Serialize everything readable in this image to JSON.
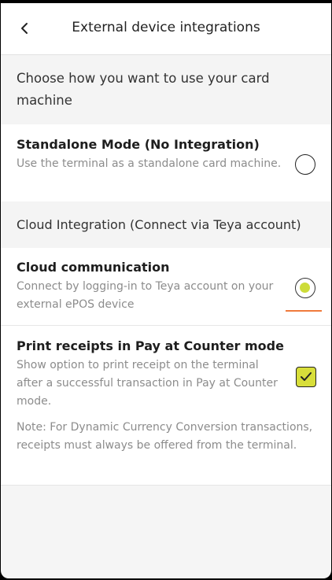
{
  "header": {
    "title": "External device integrations"
  },
  "intro": "Choose how you want to use your card machine",
  "options": {
    "standalone": {
      "title": "Standalone Mode (No Integration)",
      "description": "Use the terminal as a standalone card machine.",
      "selected": false
    },
    "cloud_section_title": "Cloud Integration (Connect via Teya account)",
    "cloud": {
      "title": "Cloud communication",
      "description": "Connect by logging-in to Teya account on your external ePOS device",
      "selected": true
    }
  },
  "print_receipts": {
    "title": "Print receipts in Pay at Counter mode",
    "description": "Show option to print receipt on the terminal after a successful transaction in Pay at Counter mode.",
    "note": "Note: For Dynamic Currency Conversion transactions, receipts must always be offered from the terminal.",
    "checked": true
  },
  "colors": {
    "accent": "#cddc39",
    "checkbox_fill": "#d8de3a",
    "focus_underline": "#f07a3c"
  },
  "icons": {
    "back": "chevron-left-icon",
    "check": "check-icon"
  }
}
